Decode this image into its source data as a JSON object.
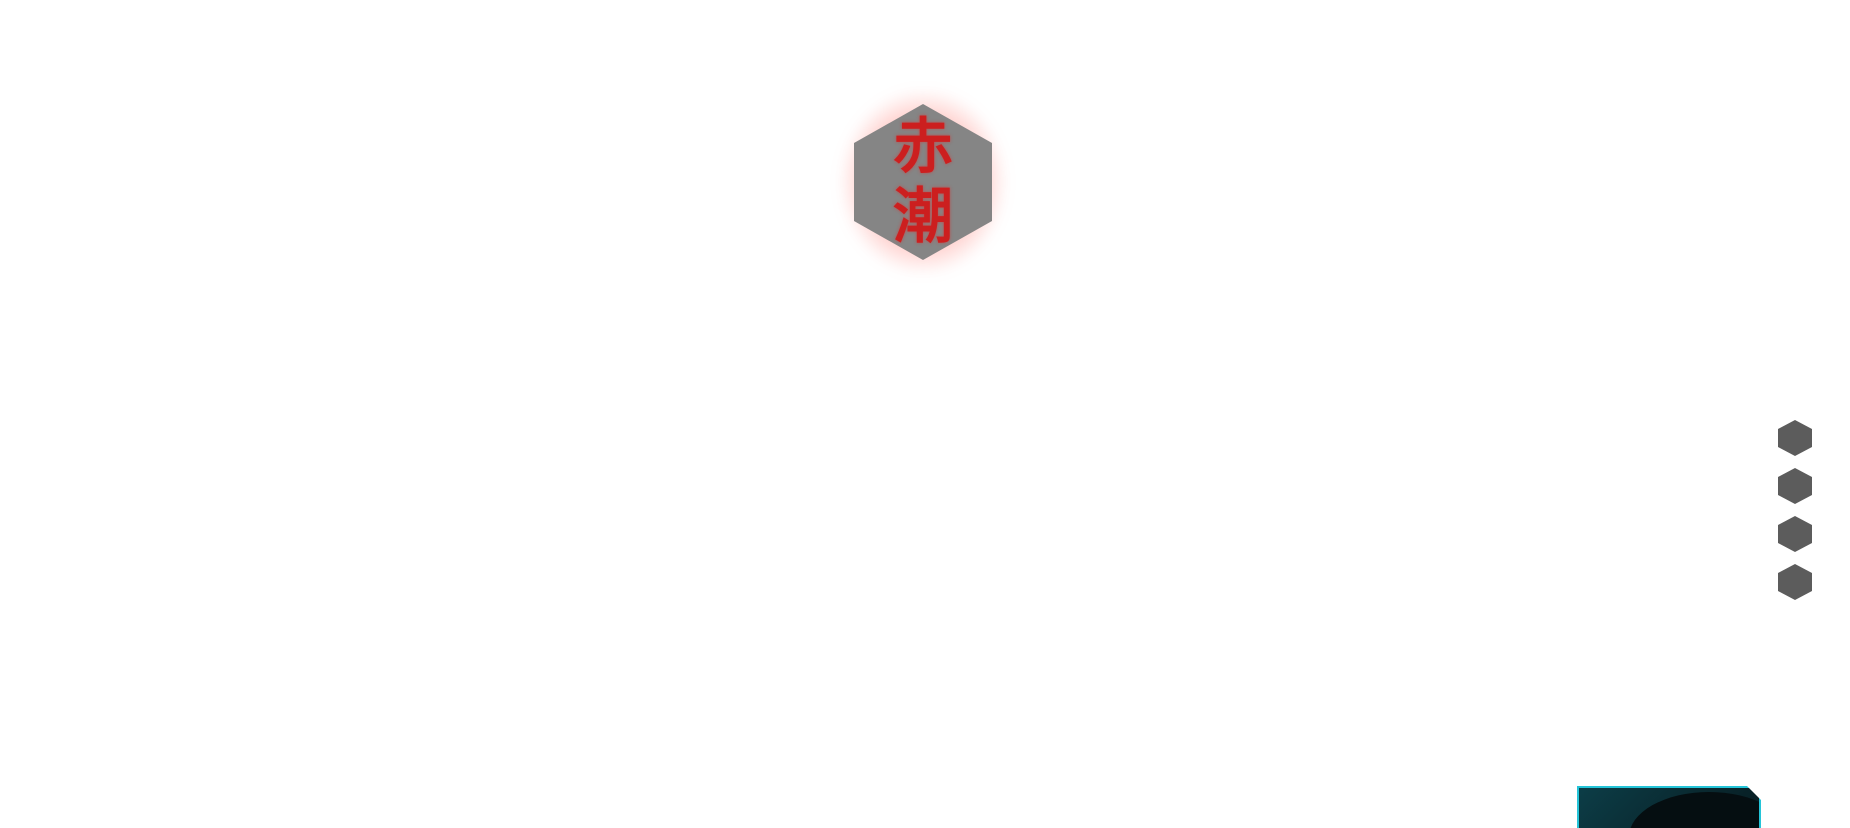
{
  "logo": {
    "char_top": "赤",
    "char_bottom": "潮"
  },
  "side_nav": {
    "item_count": 4,
    "items": [
      "",
      "",
      "",
      ""
    ]
  },
  "colors": {
    "background": "#ffffff",
    "logo_hex": "#858585",
    "logo_text": "#cc1f1f",
    "logo_glow": "#ff463c",
    "nav_dot": "#5c5c5c",
    "card_accent": "#24c4d8",
    "card_bg": "#0a2a31"
  }
}
